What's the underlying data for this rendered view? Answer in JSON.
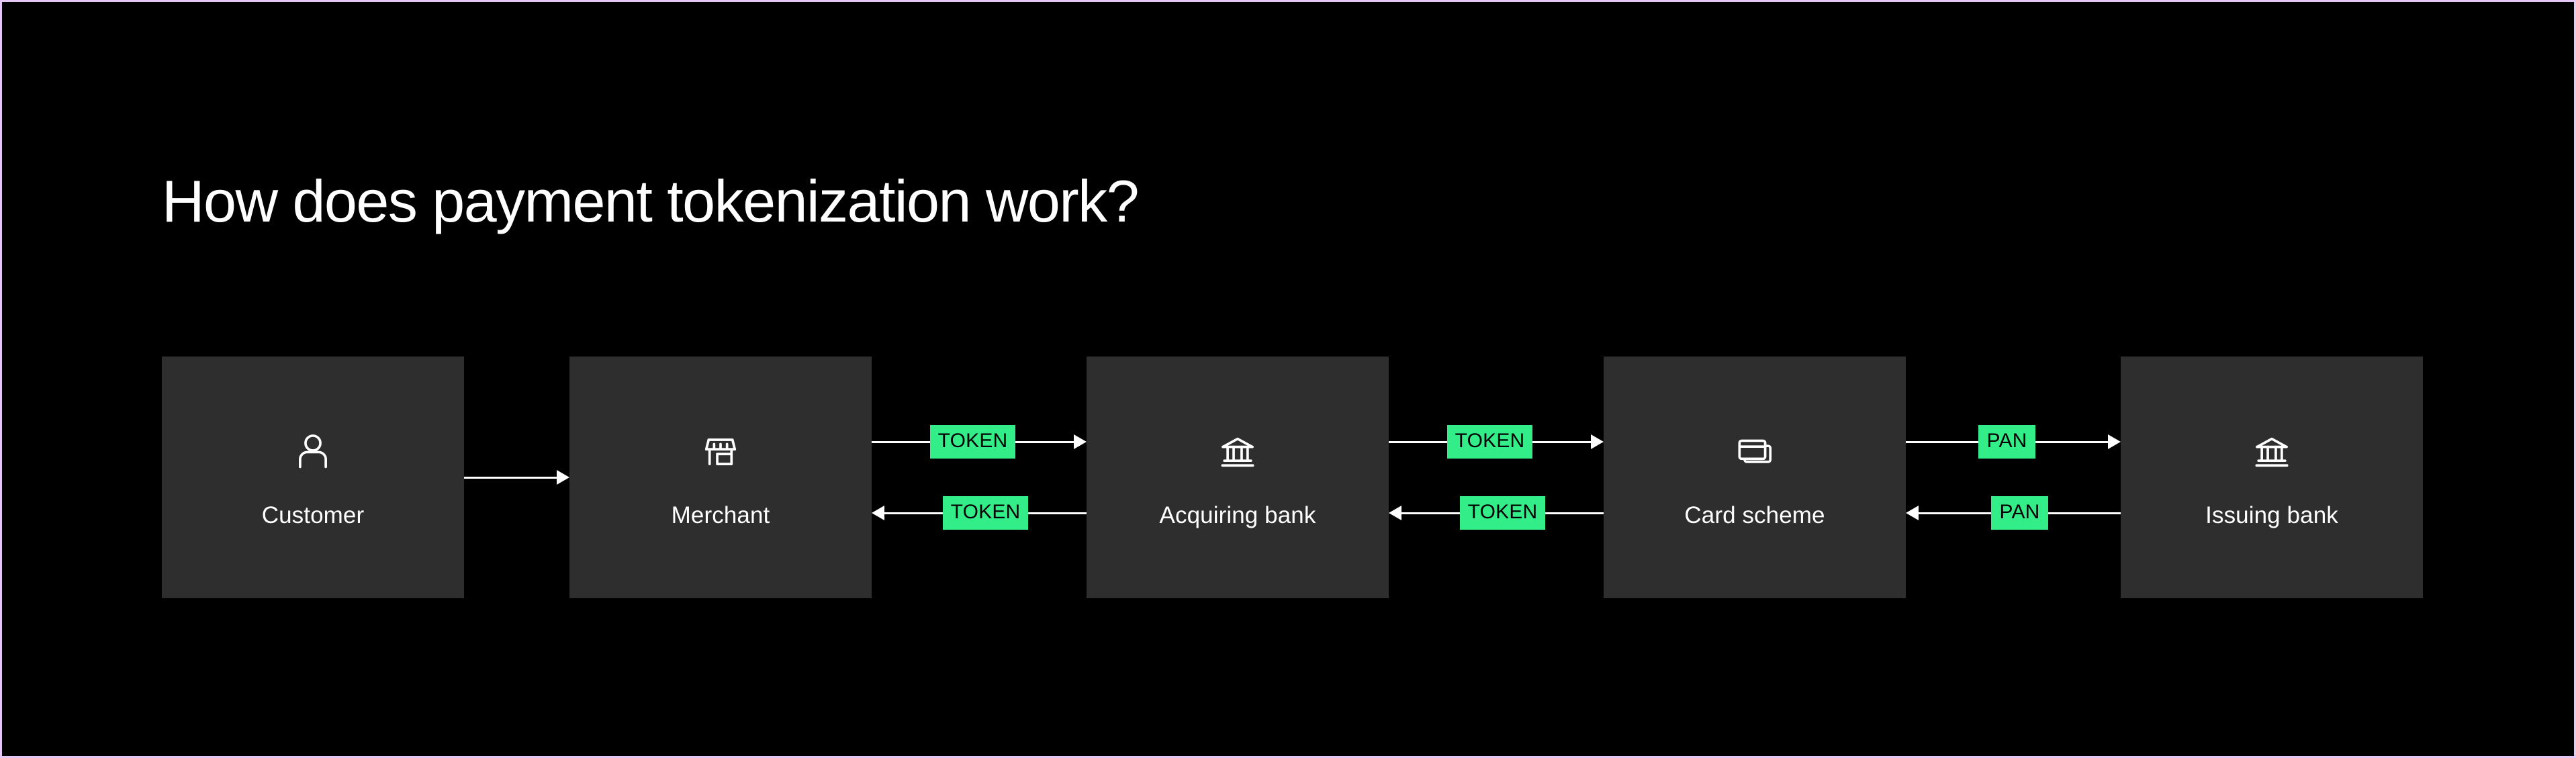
{
  "page": {
    "title": "How does payment tokenization work?",
    "background_color": "#000000",
    "border_color": "#e5c7f5",
    "card_color": "#2e2e2e",
    "accent_color": "#33ee88",
    "text_color": "#ffffff"
  },
  "diagram": {
    "type": "flow",
    "nodes": [
      {
        "id": "customer",
        "label": "Customer",
        "icon": "person-icon"
      },
      {
        "id": "merchant",
        "label": "Merchant",
        "icon": "storefront-icon"
      },
      {
        "id": "acquiring-bank",
        "label": "Acquiring bank",
        "icon": "bank-icon"
      },
      {
        "id": "card-scheme",
        "label": "Card scheme",
        "icon": "credit-cards-icon"
      },
      {
        "id": "issuing-bank",
        "label": "Issuing bank",
        "icon": "bank-icon"
      }
    ],
    "connectors": [
      {
        "id": "customer-merchant",
        "from": "customer",
        "to": "merchant",
        "style": "single",
        "flows": [
          {
            "direction": "right",
            "label": ""
          }
        ]
      },
      {
        "id": "merchant-acquiring-bank",
        "from": "merchant",
        "to": "acquiring-bank",
        "style": "double",
        "flows": [
          {
            "direction": "right",
            "label": "TOKEN"
          },
          {
            "direction": "left",
            "label": "TOKEN"
          }
        ]
      },
      {
        "id": "acquiring-bank-card-scheme",
        "from": "acquiring-bank",
        "to": "card-scheme",
        "style": "double",
        "flows": [
          {
            "direction": "right",
            "label": "TOKEN"
          },
          {
            "direction": "left",
            "label": "TOKEN"
          }
        ]
      },
      {
        "id": "card-scheme-issuing-bank",
        "from": "card-scheme",
        "to": "issuing-bank",
        "style": "double",
        "flows": [
          {
            "direction": "right",
            "label": "PAN"
          },
          {
            "direction": "left",
            "label": "PAN"
          }
        ]
      }
    ]
  }
}
